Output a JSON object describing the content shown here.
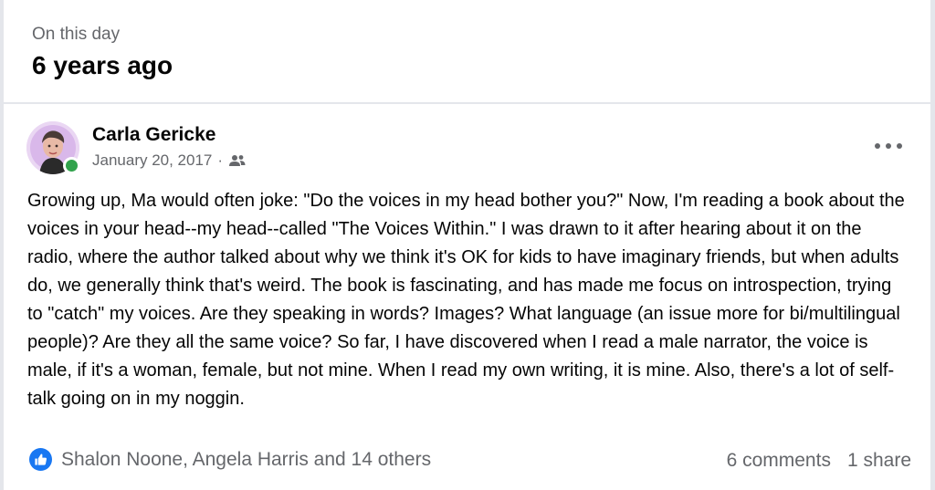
{
  "memory": {
    "label": "On this day",
    "title": "6 years ago"
  },
  "post": {
    "author": "Carla Gericke",
    "date": "January 20, 2017",
    "separator": "·",
    "audience_icon": "friends-icon",
    "body": "Growing up, Ma would often joke: \"Do the voices in my head bother you?\" Now, I'm reading a book about the voices in your head--my head--called \"The Voices Within.\" I was drawn to it after hearing about it on the radio, where the author talked about why we think it's OK for kids to have imaginary friends, but when adults do, we generally think that's weird. The book is fascinating, and has made me focus on introspection, trying to \"catch\" my voices. Are they speaking in words? Images? What language (an issue more for bi/multilingual people)? Are they all the same voice? So far, I have discovered when I read a male narrator, the voice is male, if it's a woman, female, but not mine. When I read my own writing, it is mine. Also, there's a lot of self-talk going on in my noggin."
  },
  "reactions": {
    "icon": "like-icon",
    "text": "Shalon Noone, Angela Harris and 14 others"
  },
  "stats": {
    "comments": "6 comments",
    "shares": "1 share"
  },
  "colors": {
    "accent": "#1877f2",
    "secondary_text": "#65676b",
    "online": "#31a24c",
    "divider": "#e4e6eb"
  }
}
